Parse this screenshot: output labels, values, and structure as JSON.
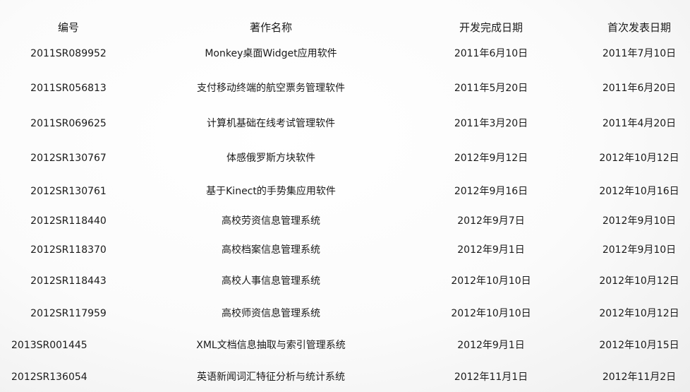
{
  "header": {
    "id": "编号",
    "name": "著作名称",
    "dev_date": "开发完成日期",
    "pub_date": "首次发表日期"
  },
  "rows": [
    {
      "id": "2011SR089952",
      "name": "Monkey桌面Widget应用软件",
      "dev_date": "2011年6月10日",
      "pub_date": "2011年7月10日"
    },
    {
      "id": "2011SR056813",
      "name": "支付移动终端的航空票务管理软件",
      "dev_date": "2011年5月20日",
      "pub_date": "2011年6月20日"
    },
    {
      "id": "2011SR069625",
      "name": "计算机基础在线考试管理软件",
      "dev_date": "2011年3月20日",
      "pub_date": "2011年4月20日"
    },
    {
      "id": "2012SR130767",
      "name": "体感俄罗斯方块软件",
      "dev_date": "2012年9月12日",
      "pub_date": "2012年10月12日"
    },
    {
      "id": "2012SR130761",
      "name": "基于Kinect的手势集应用软件",
      "dev_date": "2012年9月16日",
      "pub_date": "2012年10月16日"
    },
    {
      "id": "2012SR118440",
      "name": "高校劳资信息管理系统",
      "dev_date": "2012年9月7日",
      "pub_date": "2012年9月10日"
    },
    {
      "id": "2012SR118370",
      "name": "高校档案信息管理系统",
      "dev_date": "2012年9月1日",
      "pub_date": "2012年9月10日"
    },
    {
      "id": "2012SR118443",
      "name": "高校人事信息管理系统",
      "dev_date": "2012年10月10日",
      "pub_date": "2012年10月12日"
    },
    {
      "id": "2012SR117959",
      "name": "高校师资信息管理系统",
      "dev_date": "2012年10月10日",
      "pub_date": "2012年10月12日"
    },
    {
      "id": "2013SR001445",
      "name": "XML文档信息抽取与索引管理系统",
      "dev_date": "2012年9月1日",
      "pub_date": "2012年10月15日"
    },
    {
      "id": "2012SR136054",
      "name": "英语新闻词汇特征分析与统计系统",
      "dev_date": "2012年11月1日",
      "pub_date": "2012年11月2日"
    }
  ]
}
